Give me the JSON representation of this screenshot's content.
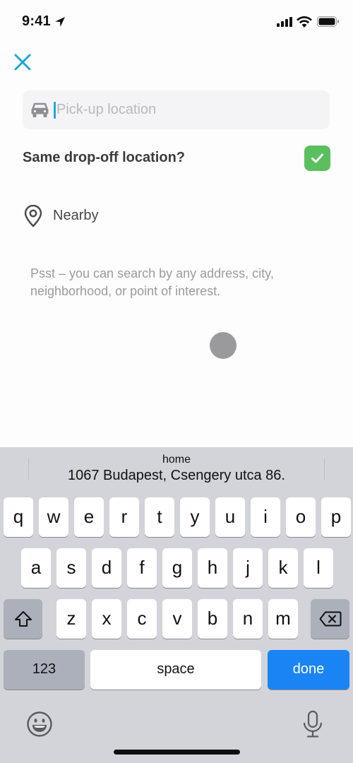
{
  "status_bar": {
    "time": "9:41",
    "icons": [
      "location-arrow-icon",
      "cellular-signal-icon",
      "wifi-icon",
      "battery-icon"
    ]
  },
  "header": {
    "close_icon": "close-icon",
    "accent_color": "#1ba8d8"
  },
  "pickup": {
    "icon": "car-icon",
    "value": "",
    "placeholder": "Pick-up location"
  },
  "same_dropoff": {
    "label": "Same drop-off location?",
    "checked": true,
    "check_color": "#5cbf5f"
  },
  "nearby": {
    "icon": "location-pin-icon",
    "label": "Nearby"
  },
  "hint": {
    "text": "Psst – you can search by any address, city, neighborhood, or point of interest."
  },
  "keyboard": {
    "suggestion": {
      "title": "home",
      "address": "1067 Budapest, Csengery utca 86."
    },
    "rows": [
      [
        "q",
        "w",
        "e",
        "r",
        "t",
        "y",
        "u",
        "i",
        "o",
        "p"
      ],
      [
        "a",
        "s",
        "d",
        "f",
        "g",
        "h",
        "j",
        "k",
        "l"
      ],
      [
        "z",
        "x",
        "c",
        "v",
        "b",
        "n",
        "m"
      ]
    ],
    "shift_icon": "shift-icon",
    "delete_icon": "backspace-icon",
    "numbers_label": "123",
    "space_label": "space",
    "done_label": "done",
    "done_color": "#1a84f5",
    "emoji_icon": "emoji-icon",
    "mic_icon": "microphone-icon"
  }
}
